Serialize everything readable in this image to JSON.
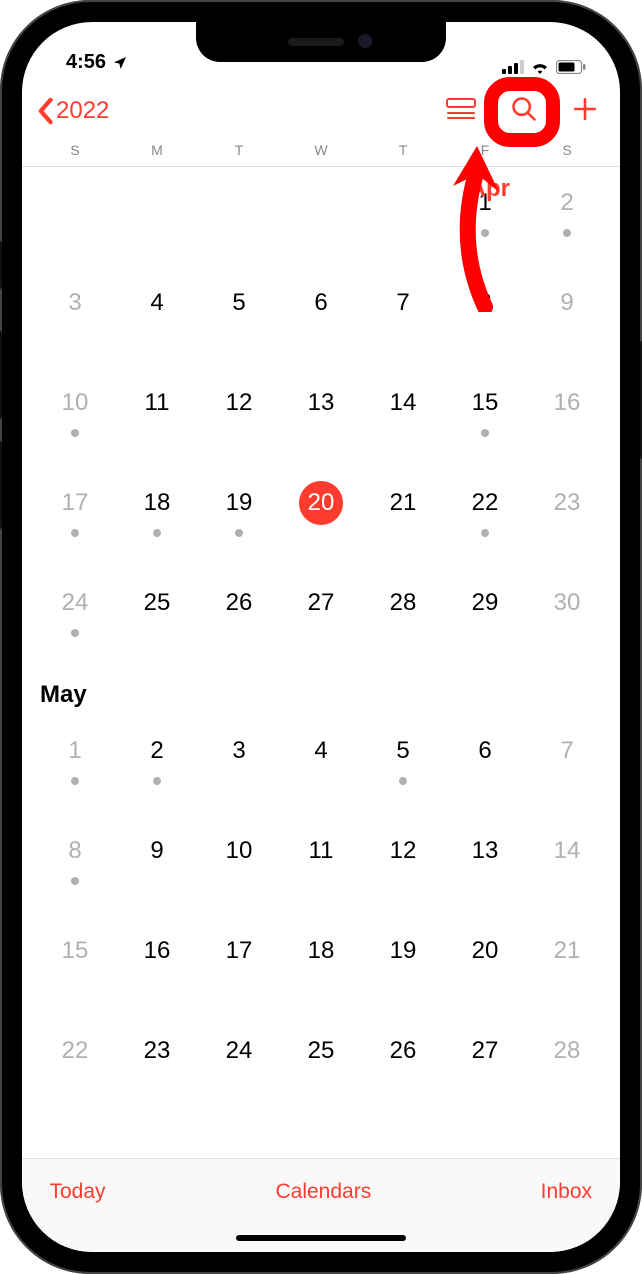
{
  "status": {
    "time": "4:56",
    "location_icon": "location-arrow"
  },
  "nav": {
    "back_label": "2022"
  },
  "weekdays": [
    "S",
    "M",
    "T",
    "W",
    "T",
    "F",
    "S"
  ],
  "months": [
    {
      "name": "Apr",
      "highlight_color": "#ff3b30",
      "label_inline": true,
      "weeks": [
        [
          {
            "n": "",
            "we": true
          },
          {
            "n": ""
          },
          {
            "n": ""
          },
          {
            "n": ""
          },
          {
            "n": ""
          },
          {
            "n": "1",
            "dot": true
          },
          {
            "n": "2",
            "we": true,
            "dot": true
          }
        ],
        [
          {
            "n": "3",
            "we": true
          },
          {
            "n": "4"
          },
          {
            "n": "5"
          },
          {
            "n": "6"
          },
          {
            "n": "7"
          },
          {
            "n": "8"
          },
          {
            "n": "9",
            "we": true
          }
        ],
        [
          {
            "n": "10",
            "we": true,
            "dot": true
          },
          {
            "n": "11"
          },
          {
            "n": "12"
          },
          {
            "n": "13"
          },
          {
            "n": "14"
          },
          {
            "n": "15",
            "dot": true
          },
          {
            "n": "16",
            "we": true
          }
        ],
        [
          {
            "n": "17",
            "we": true,
            "dot": true
          },
          {
            "n": "18",
            "dot": true
          },
          {
            "n": "19",
            "dot": true
          },
          {
            "n": "20",
            "today": true
          },
          {
            "n": "21"
          },
          {
            "n": "22",
            "dot": true
          },
          {
            "n": "23",
            "we": true
          }
        ],
        [
          {
            "n": "24",
            "we": true,
            "dot": true
          },
          {
            "n": "25"
          },
          {
            "n": "26"
          },
          {
            "n": "27"
          },
          {
            "n": "28"
          },
          {
            "n": "29"
          },
          {
            "n": "30",
            "we": true
          }
        ]
      ]
    },
    {
      "name": "May",
      "label_inline": false,
      "weeks": [
        [
          {
            "n": "1",
            "we": true,
            "dot": true
          },
          {
            "n": "2",
            "dot": true
          },
          {
            "n": "3"
          },
          {
            "n": "4"
          },
          {
            "n": "5",
            "dot": true
          },
          {
            "n": "6"
          },
          {
            "n": "7",
            "we": true
          }
        ],
        [
          {
            "n": "8",
            "we": true,
            "dot": true
          },
          {
            "n": "9"
          },
          {
            "n": "10"
          },
          {
            "n": "11"
          },
          {
            "n": "12"
          },
          {
            "n": "13"
          },
          {
            "n": "14",
            "we": true
          }
        ],
        [
          {
            "n": "15",
            "we": true
          },
          {
            "n": "16"
          },
          {
            "n": "17"
          },
          {
            "n": "18"
          },
          {
            "n": "19"
          },
          {
            "n": "20"
          },
          {
            "n": "21",
            "we": true
          }
        ],
        [
          {
            "n": "22",
            "we": true
          },
          {
            "n": "23"
          },
          {
            "n": "24"
          },
          {
            "n": "25"
          },
          {
            "n": "26"
          },
          {
            "n": "27"
          },
          {
            "n": "28",
            "we": true
          }
        ]
      ]
    }
  ],
  "toolbar": {
    "today": "Today",
    "calendars": "Calendars",
    "inbox": "Inbox"
  }
}
